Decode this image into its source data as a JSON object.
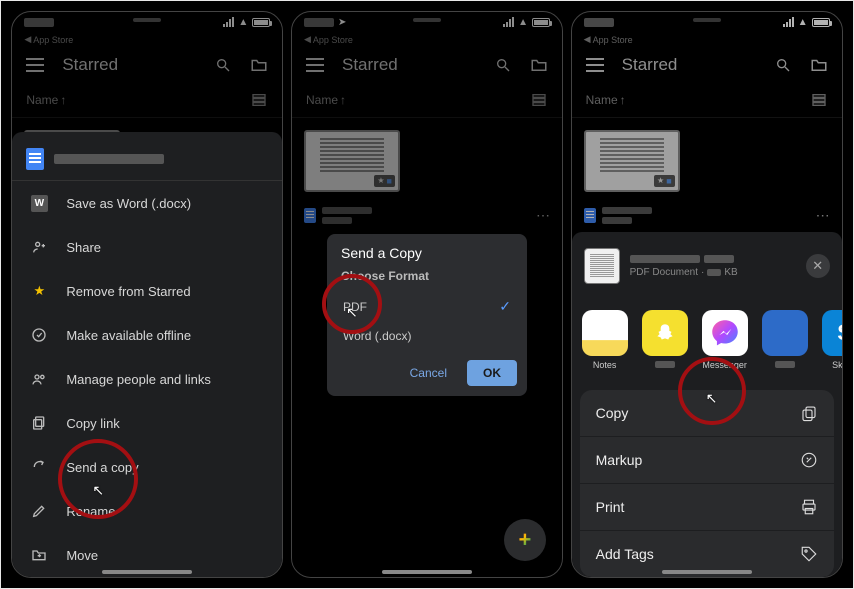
{
  "status": {
    "back_label": "App Store"
  },
  "header": {
    "title": "Starred"
  },
  "listHeader": {
    "name": "Name"
  },
  "menu": {
    "items": {
      "saveWord": "Save as Word (.docx)",
      "share": "Share",
      "removeStarred": "Remove from Starred",
      "offline": "Make available offline",
      "managePeople": "Manage people and links",
      "copyLink": "Copy link",
      "sendCopy": "Send a copy",
      "rename": "Rename",
      "move": "Move"
    }
  },
  "modal": {
    "title": "Send a Copy",
    "heading": "Choose Format",
    "optPdf": "PDF",
    "optWord": "Word (.docx)",
    "cancel": "Cancel",
    "ok": "OK"
  },
  "share": {
    "docType": "PDF Document",
    "docSize": "KB",
    "apps": {
      "notes": "Notes",
      "messenger": "Messenger",
      "skype": "Skype"
    },
    "actions": {
      "copy": "Copy",
      "markup": "Markup",
      "print": "Print",
      "addTags": "Add Tags"
    }
  }
}
